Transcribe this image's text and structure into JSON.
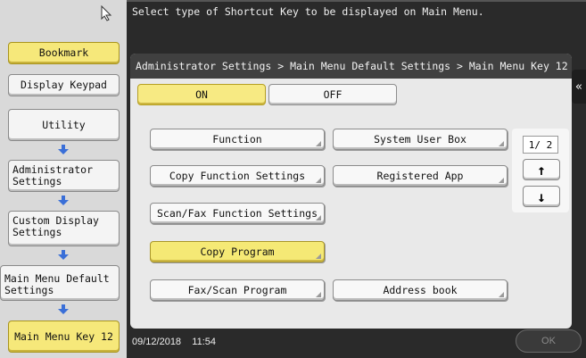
{
  "header": {
    "message": "Select type of Shortcut Key to be displayed on Main Menu."
  },
  "sidebar": {
    "bookmark": "Bookmark",
    "display_keypad": "Display Keypad",
    "items": [
      {
        "label": "Utility"
      },
      {
        "label": "Administrator Settings"
      },
      {
        "label": "Custom Display Settings"
      },
      {
        "label": "Main Menu Default Settings"
      },
      {
        "label": "Main Menu Key 12"
      }
    ]
  },
  "breadcrumb": "Administrator Settings > Main Menu Default Settings > Main Menu Key 12",
  "toggle": {
    "on": "ON",
    "off": "OFF",
    "selected": "ON"
  },
  "options": {
    "function": "Function",
    "system_user_box": "System User Box",
    "copy_function_settings": "Copy Function Settings",
    "registered_app": "Registered App",
    "scan_fax_function_settings": "Scan/Fax Function Settings",
    "copy_program": "Copy Program",
    "fax_scan_program": "Fax/Scan Program",
    "address_book": "Address book",
    "selected": "Copy Program"
  },
  "pagination": {
    "page": "1/ 2",
    "up": "↑",
    "down": "↓"
  },
  "back_glyph": "«",
  "footer": {
    "datetime": "09/12/2018    11:54",
    "ok": "OK"
  },
  "colors": {
    "accent_yellow": "#f6e87a",
    "arrow_blue": "#3a6fd8",
    "dark_bg": "#2a2a2a"
  }
}
